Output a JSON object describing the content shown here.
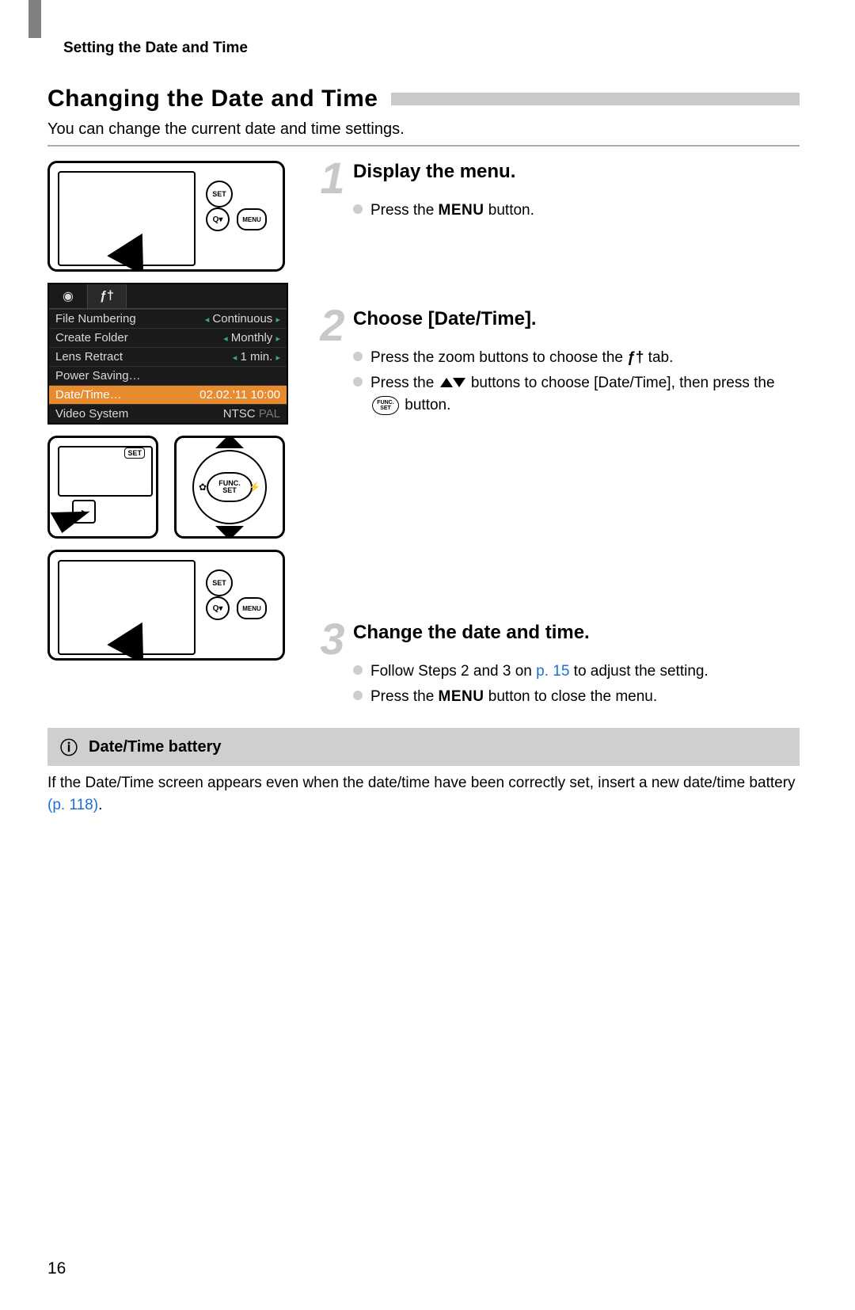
{
  "page": {
    "running_head": "Setting the Date and Time",
    "title": "Changing the Date and Time",
    "intro": "You can change the current date and time settings.",
    "page_number": "16"
  },
  "menu_screenshot": {
    "tabs": {
      "camera_icon": "📷",
      "tools_icon": "🛠"
    },
    "rows": [
      {
        "label": "File Numbering",
        "value": "Continuous",
        "has_arrows": true
      },
      {
        "label": "Create Folder",
        "value": "Monthly",
        "has_arrows": true
      },
      {
        "label": "Lens Retract",
        "value": "1 min.",
        "has_arrows": true
      },
      {
        "label": "Power Saving…",
        "value": ""
      },
      {
        "label": "Date/Time…",
        "value": "02.02.'11 10:00",
        "selected": true
      },
      {
        "label": "Video System",
        "value": "NTSC",
        "alt": "PAL"
      }
    ]
  },
  "illus_labels": {
    "set_btn": "SET",
    "menu_btn": "MENU",
    "func": "FUNC.",
    "set": "SET"
  },
  "steps": [
    {
      "num": "1",
      "title": "Display the menu.",
      "bullets": [
        {
          "pre": "Press the ",
          "btn": "MENU",
          "post": " button."
        }
      ]
    },
    {
      "num": "2",
      "title": "Choose [Date/Time].",
      "bullets": [
        {
          "pre": "Press the zoom buttons to choose the ",
          "icon": "tools",
          "post": " tab."
        },
        {
          "pre": "Press the ",
          "icon": "updown",
          "mid": " buttons to choose [Date/Time], then press the ",
          "icon2": "funcset",
          "post": " button."
        }
      ]
    },
    {
      "num": "3",
      "title": "Change the date and time.",
      "bullets": [
        {
          "pre": "Follow Steps 2 and 3 on ",
          "link": "p. 15",
          "post": " to adjust the setting."
        },
        {
          "pre": "Press the ",
          "btn": "MENU",
          "post": " button to close the menu."
        }
      ]
    }
  ],
  "tip": {
    "title": "Date/Time battery",
    "text_pre": "If the Date/Time screen appears even when the date/time have been correctly set, insert a new date/time battery ",
    "link": "(p. 118)",
    "text_post": "."
  }
}
